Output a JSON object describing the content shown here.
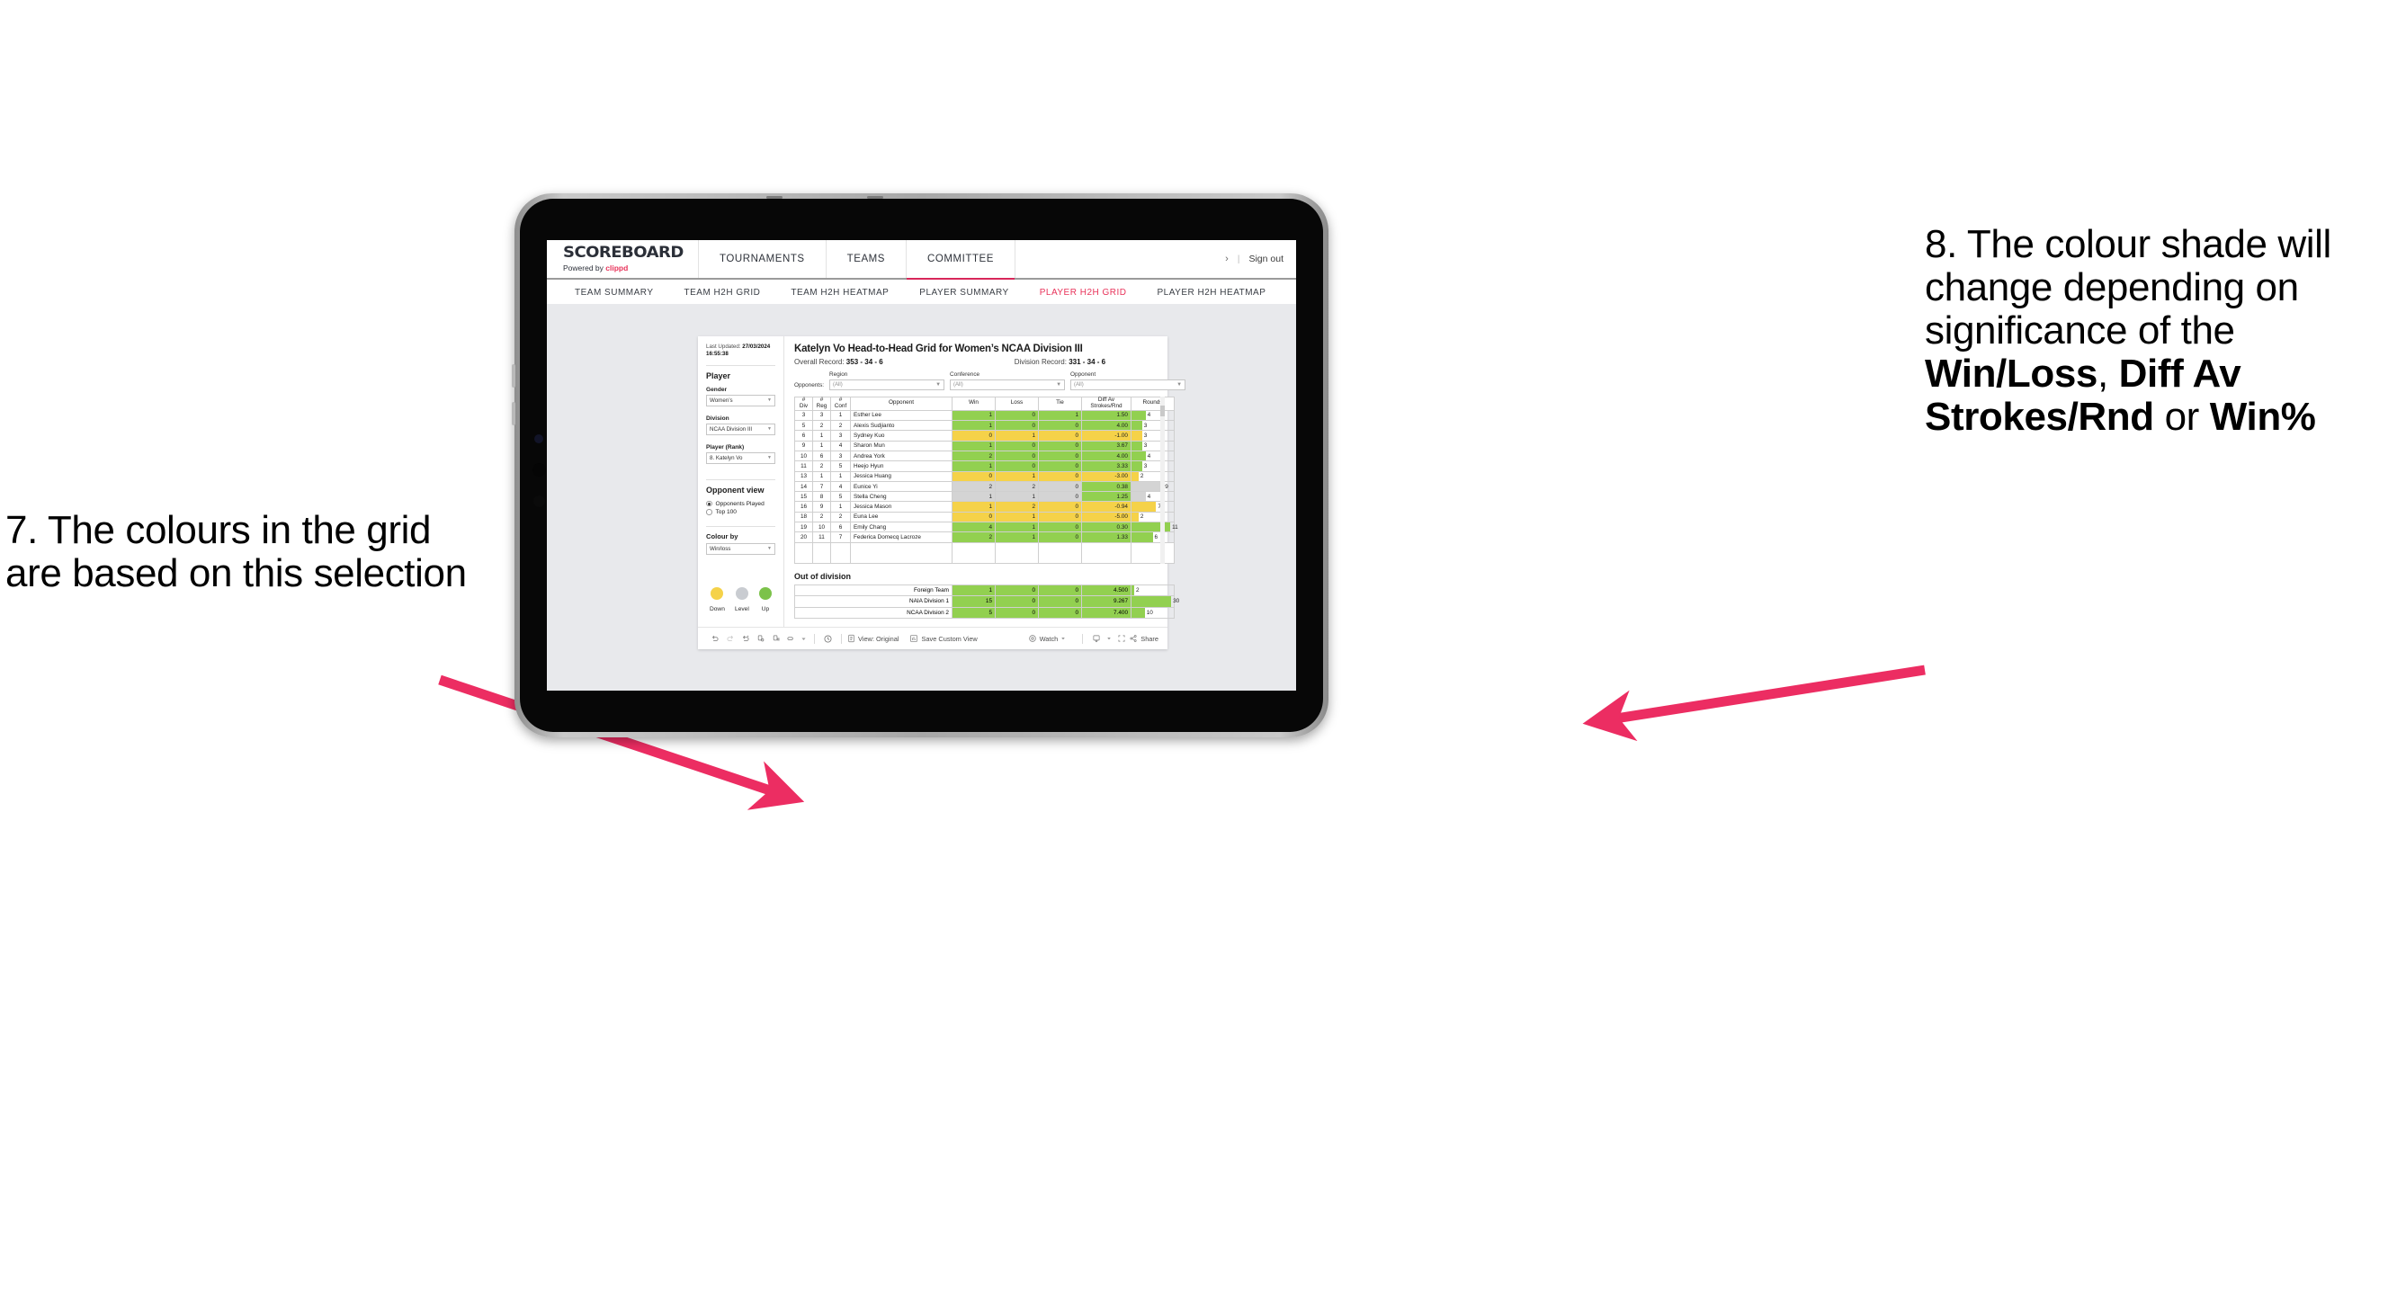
{
  "annotations": {
    "left": {
      "id": "7",
      "text": "7. The colours in the grid are based on this selection"
    },
    "right": {
      "id": "8",
      "pre": "8. The colour shade will change depending on significance of the ",
      "bold1": "Win/Loss",
      "mid1": ", ",
      "bold2": "Diff Av Strokes/Rnd",
      "mid2": " or ",
      "bold3": "Win%"
    },
    "arrow_color": "#ec2d62"
  },
  "app": {
    "brand": {
      "name": "SCOREBOARD",
      "powered_prefix": "Powered by ",
      "powered_brand": "clippd"
    },
    "top_nav": [
      {
        "label": "TOURNAMENTS",
        "active": false
      },
      {
        "label": "TEAMS",
        "active": false
      },
      {
        "label": "COMMITTEE",
        "active": true
      }
    ],
    "top_right": {
      "chevron": "›",
      "separator": "|",
      "sign_out": "Sign out"
    },
    "sub_nav": [
      {
        "label": "TEAM SUMMARY",
        "active": false
      },
      {
        "label": "TEAM H2H GRID",
        "active": false
      },
      {
        "label": "TEAM H2H HEATMAP",
        "active": false
      },
      {
        "label": "PLAYER SUMMARY",
        "active": false
      },
      {
        "label": "PLAYER H2H GRID",
        "active": true
      },
      {
        "label": "PLAYER H2H HEATMAP",
        "active": false
      }
    ],
    "accent_color": "#e8335a"
  },
  "sidebar": {
    "last_updated_label": "Last Updated: ",
    "last_updated_value": "27/03/2024 16:55:38",
    "player_section_title": "Player",
    "fields": [
      {
        "label": "Gender",
        "value": "Women’s"
      },
      {
        "label": "Division",
        "value": "NCAA Division III"
      },
      {
        "label": "Player (Rank)",
        "value": "8. Katelyn Vo"
      }
    ],
    "opponent_view": {
      "title": "Opponent view",
      "options": [
        {
          "label": "Opponents Played",
          "selected": true
        },
        {
          "label": "Top 100",
          "selected": false
        }
      ]
    },
    "colour_by": {
      "label": "Colour by",
      "value": "Win/loss"
    },
    "legend": [
      {
        "label": "Down",
        "color": "#f5d249"
      },
      {
        "label": "Level",
        "color": "#c9ccd1"
      },
      {
        "label": "Up",
        "color": "#7cc24a"
      }
    ]
  },
  "main": {
    "title": "Katelyn Vo Head-to-Head Grid for Women’s NCAA Division III",
    "overall_record_label": "Overall Record: ",
    "overall_record_value": "353 -  34 - 6",
    "division_record_label": "Division Record: ",
    "division_record_value": "331 -  34 - 6",
    "opponents_label": "Opponents:",
    "filters": [
      {
        "label": "Region",
        "value": "(All)"
      },
      {
        "label": "Conference",
        "value": "(All)"
      },
      {
        "label": "Opponent",
        "value": "(All)"
      }
    ],
    "columns": [
      "# Div",
      "# Reg",
      "# Conf",
      "Opponent",
      "Win",
      "Loss",
      "Tie",
      "Diff Av Strokes/Rnd",
      "Rounds"
    ],
    "column_lines": [
      [
        "#",
        "Div"
      ],
      [
        "#",
        "Reg"
      ],
      [
        "#",
        "Conf"
      ],
      [
        "Opponent",
        ""
      ],
      [
        "Win",
        ""
      ],
      [
        "Loss",
        ""
      ],
      [
        "Tie",
        ""
      ],
      [
        "Diff Av",
        "Strokes/Rnd"
      ],
      [
        "Rounds",
        ""
      ]
    ],
    "out_of_division_title": "Out of division"
  },
  "chart_data": {
    "type": "table",
    "title": "Katelyn Vo Head-to-Head Grid for Women’s NCAA Division III",
    "columns": [
      "# Div",
      "# Reg",
      "# Conf",
      "Opponent",
      "Win",
      "Loss",
      "Tie",
      "Diff Av Strokes/Rnd",
      "Rounds"
    ],
    "colour_scale": {
      "up": "#92d050",
      "level": "#d4d4d4",
      "down": "#f5d249"
    },
    "rounds_max": 12,
    "rows": [
      {
        "div": "3",
        "reg": "3",
        "conf": "1",
        "opponent": "Esther Lee",
        "win": "1",
        "loss": "0",
        "tie": "1",
        "diff": "1.50",
        "rounds": "4",
        "state": "up"
      },
      {
        "div": "5",
        "reg": "2",
        "conf": "2",
        "opponent": "Alexis Sudjianto",
        "win": "1",
        "loss": "0",
        "tie": "0",
        "diff": "4.00",
        "rounds": "3",
        "state": "up"
      },
      {
        "div": "6",
        "reg": "1",
        "conf": "3",
        "opponent": "Sydney Kuo",
        "win": "0",
        "loss": "1",
        "tie": "0",
        "diff": "-1.00",
        "rounds": "3",
        "state": "down"
      },
      {
        "div": "9",
        "reg": "1",
        "conf": "4",
        "opponent": "Sharon Mun",
        "win": "1",
        "loss": "0",
        "tie": "0",
        "diff": "3.67",
        "rounds": "3",
        "state": "up"
      },
      {
        "div": "10",
        "reg": "6",
        "conf": "3",
        "opponent": "Andrea York",
        "win": "2",
        "loss": "0",
        "tie": "0",
        "diff": "4.00",
        "rounds": "4",
        "state": "up"
      },
      {
        "div": "11",
        "reg": "2",
        "conf": "5",
        "opponent": "Heejo Hyun",
        "win": "1",
        "loss": "0",
        "tie": "0",
        "diff": "3.33",
        "rounds": "3",
        "state": "up"
      },
      {
        "div": "13",
        "reg": "1",
        "conf": "1",
        "opponent": "Jessica Huang",
        "win": "0",
        "loss": "1",
        "tie": "0",
        "diff": "-3.00",
        "rounds": "2",
        "state": "down"
      },
      {
        "div": "14",
        "reg": "7",
        "conf": "4",
        "opponent": "Eunice Yi",
        "win": "2",
        "loss": "2",
        "tie": "0",
        "diff": "0.38",
        "rounds": "9",
        "state": "level",
        "diff_state": "up"
      },
      {
        "div": "15",
        "reg": "8",
        "conf": "5",
        "opponent": "Stella Cheng",
        "win": "1",
        "loss": "1",
        "tie": "0",
        "diff": "1.25",
        "rounds": "4",
        "state": "level",
        "diff_state": "up"
      },
      {
        "div": "16",
        "reg": "9",
        "conf": "1",
        "opponent": "Jessica Mason",
        "win": "1",
        "loss": "2",
        "tie": "0",
        "diff": "-0.94",
        "rounds": "7",
        "state": "down"
      },
      {
        "div": "18",
        "reg": "2",
        "conf": "2",
        "opponent": "Euna Lee",
        "win": "0",
        "loss": "1",
        "tie": "0",
        "diff": "-5.00",
        "rounds": "2",
        "state": "down"
      },
      {
        "div": "19",
        "reg": "10",
        "conf": "6",
        "opponent": "Emily Chang",
        "win": "4",
        "loss": "1",
        "tie": "0",
        "diff": "0.30",
        "rounds": "11",
        "state": "up"
      },
      {
        "div": "20",
        "reg": "11",
        "conf": "7",
        "opponent": "Federica Domecq Lacroze",
        "win": "2",
        "loss": "1",
        "tie": "0",
        "diff": "1.33",
        "rounds": "6",
        "state": "up"
      }
    ],
    "out_of_division": {
      "title": "Out of division",
      "rounds_max": 32,
      "rows": [
        {
          "opponent": "Foreign Team",
          "win": "1",
          "loss": "0",
          "tie": "0",
          "diff": "4.500",
          "rounds": "2",
          "state": "up"
        },
        {
          "opponent": "NAIA Division 1",
          "win": "15",
          "loss": "0",
          "tie": "0",
          "diff": "9.267",
          "rounds": "30",
          "state": "up"
        },
        {
          "opponent": "NCAA Division 2",
          "win": "5",
          "loss": "0",
          "tie": "0",
          "diff": "7.400",
          "rounds": "10",
          "state": "up"
        }
      ]
    }
  },
  "footer": {
    "icons": [
      "undo-icon",
      "redo-icon",
      "revert-icon",
      "refresh-data-icon",
      "pause-refresh-icon",
      "alerts-icon",
      "dropdown-caret-icon",
      "history-icon"
    ],
    "view_label": "View: Original",
    "save_custom_view_label": "Save Custom View",
    "watch_label": "Watch",
    "share_label": "Share"
  }
}
